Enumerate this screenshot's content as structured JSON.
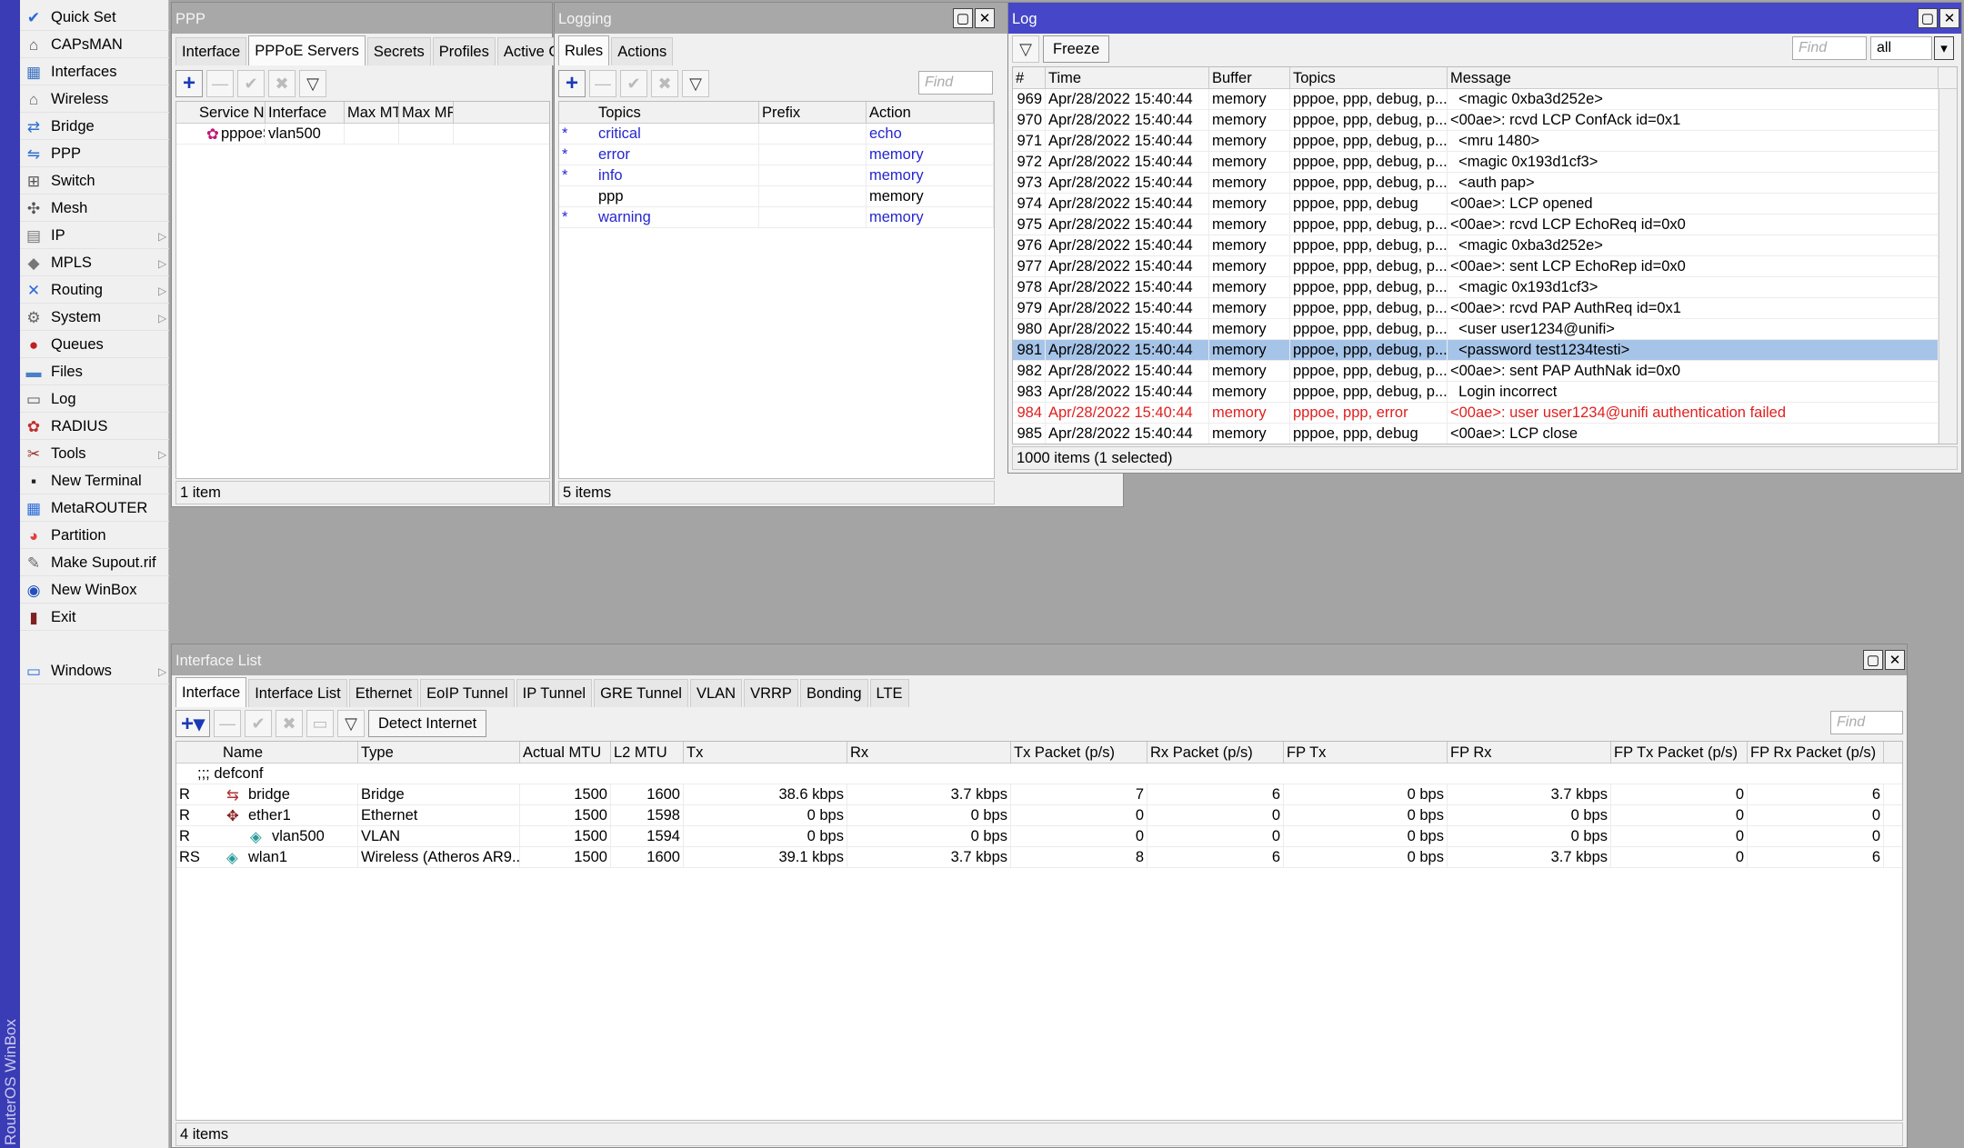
{
  "brand": "RouterOS WinBox",
  "menu": [
    {
      "label": "Quick Set",
      "icon": "quick-set-icon",
      "glyph": "✔",
      "sub": false
    },
    {
      "label": "CAPsMAN",
      "icon": "capsman-icon",
      "glyph": "⌂",
      "sub": false
    },
    {
      "label": "Interfaces",
      "icon": "interfaces-icon",
      "glyph": "▦",
      "sub": false
    },
    {
      "label": "Wireless",
      "icon": "wireless-icon",
      "glyph": "⌂",
      "sub": false
    },
    {
      "label": "Bridge",
      "icon": "bridge-icon",
      "glyph": "⇄",
      "sub": false
    },
    {
      "label": "PPP",
      "icon": "ppp-icon",
      "glyph": "⇋",
      "sub": false
    },
    {
      "label": "Switch",
      "icon": "switch-icon",
      "glyph": "⊞",
      "sub": false
    },
    {
      "label": "Mesh",
      "icon": "mesh-icon",
      "glyph": "✣",
      "sub": false
    },
    {
      "label": "IP",
      "icon": "ip-icon",
      "glyph": "▤",
      "sub": true
    },
    {
      "label": "MPLS",
      "icon": "mpls-icon",
      "glyph": "◆",
      "sub": true
    },
    {
      "label": "Routing",
      "icon": "routing-icon",
      "glyph": "✕",
      "sub": true
    },
    {
      "label": "System",
      "icon": "system-icon",
      "glyph": "⚙",
      "sub": true
    },
    {
      "label": "Queues",
      "icon": "queues-icon",
      "glyph": "●",
      "sub": false
    },
    {
      "label": "Files",
      "icon": "files-icon",
      "glyph": "▬",
      "sub": false
    },
    {
      "label": "Log",
      "icon": "log-icon",
      "glyph": "▭",
      "sub": false
    },
    {
      "label": "RADIUS",
      "icon": "radius-icon",
      "glyph": "✿",
      "sub": false
    },
    {
      "label": "Tools",
      "icon": "tools-icon",
      "glyph": "✂",
      "sub": true
    },
    {
      "label": "New Terminal",
      "icon": "terminal-icon",
      "glyph": "▪",
      "sub": false
    },
    {
      "label": "MetaROUTER",
      "icon": "metarouter-icon",
      "glyph": "▦",
      "sub": false
    },
    {
      "label": "Partition",
      "icon": "partition-icon",
      "glyph": "◕",
      "sub": false
    },
    {
      "label": "Make Supout.rif",
      "icon": "supout-icon",
      "glyph": "✎",
      "sub": false
    },
    {
      "label": "New WinBox",
      "icon": "winbox-icon",
      "glyph": "◉",
      "sub": false
    },
    {
      "label": "Exit",
      "icon": "exit-icon",
      "glyph": "▮",
      "sub": false
    },
    {
      "label": "Windows",
      "icon": "windows-icon",
      "glyph": "▭",
      "sub": true
    }
  ],
  "ppp": {
    "title": "PPP",
    "tabs": [
      "Interface",
      "PPPoE Servers",
      "Secrets",
      "Profiles",
      "Active Co"
    ],
    "selected_tab": 1,
    "columns": [
      "Service Na...",
      "Interface",
      "Max MTU",
      "Max MRU"
    ],
    "rows": [
      [
        "pppoeS...",
        "vlan500",
        "",
        ""
      ]
    ],
    "status": "1 item"
  },
  "logging": {
    "title": "Logging",
    "tabs": [
      "Rules",
      "Actions"
    ],
    "selected_tab": 0,
    "find": "Find",
    "columns": [
      "Topics",
      "Prefix",
      "Action"
    ],
    "rows": [
      {
        "mark": "*",
        "topics": "critical",
        "prefix": "",
        "action": "echo",
        "disabled": true
      },
      {
        "mark": "*",
        "topics": "error",
        "prefix": "",
        "action": "memory",
        "disabled": true
      },
      {
        "mark": "*",
        "topics": "info",
        "prefix": "",
        "action": "memory",
        "disabled": true
      },
      {
        "mark": "",
        "topics": "ppp",
        "prefix": "",
        "action": "memory",
        "disabled": false
      },
      {
        "mark": "*",
        "topics": "warning",
        "prefix": "",
        "action": "memory",
        "disabled": true
      }
    ],
    "status": "5 items"
  },
  "log": {
    "title": "Log",
    "freeze": "Freeze",
    "find": "Find",
    "filter_value": "all",
    "columns": [
      "#",
      "Time",
      "Buffer",
      "Topics",
      "Message"
    ],
    "rows": [
      {
        "n": "969",
        "time": "Apr/28/2022 15:40:44",
        "buf": "memory",
        "topics": "pppoe, ppp, debug, p...",
        "msg": "  <magic 0xba3d252e>",
        "st": ""
      },
      {
        "n": "970",
        "time": "Apr/28/2022 15:40:44",
        "buf": "memory",
        "topics": "pppoe, ppp, debug, p...",
        "msg": "<00ae>: rcvd LCP ConfAck id=0x1",
        "st": ""
      },
      {
        "n": "971",
        "time": "Apr/28/2022 15:40:44",
        "buf": "memory",
        "topics": "pppoe, ppp, debug, p...",
        "msg": "  <mru 1480>",
        "st": ""
      },
      {
        "n": "972",
        "time": "Apr/28/2022 15:40:44",
        "buf": "memory",
        "topics": "pppoe, ppp, debug, p...",
        "msg": "  <magic 0x193d1cf3>",
        "st": ""
      },
      {
        "n": "973",
        "time": "Apr/28/2022 15:40:44",
        "buf": "memory",
        "topics": "pppoe, ppp, debug, p...",
        "msg": "  <auth pap>",
        "st": ""
      },
      {
        "n": "974",
        "time": "Apr/28/2022 15:40:44",
        "buf": "memory",
        "topics": "pppoe, ppp, debug",
        "msg": "<00ae>: LCP opened",
        "st": ""
      },
      {
        "n": "975",
        "time": "Apr/28/2022 15:40:44",
        "buf": "memory",
        "topics": "pppoe, ppp, debug, p...",
        "msg": "<00ae>: rcvd LCP EchoReq id=0x0",
        "st": ""
      },
      {
        "n": "976",
        "time": "Apr/28/2022 15:40:44",
        "buf": "memory",
        "topics": "pppoe, ppp, debug, p...",
        "msg": "  <magic 0xba3d252e>",
        "st": ""
      },
      {
        "n": "977",
        "time": "Apr/28/2022 15:40:44",
        "buf": "memory",
        "topics": "pppoe, ppp, debug, p...",
        "msg": "<00ae>: sent LCP EchoRep id=0x0",
        "st": ""
      },
      {
        "n": "978",
        "time": "Apr/28/2022 15:40:44",
        "buf": "memory",
        "topics": "pppoe, ppp, debug, p...",
        "msg": "  <magic 0x193d1cf3>",
        "st": ""
      },
      {
        "n": "979",
        "time": "Apr/28/2022 15:40:44",
        "buf": "memory",
        "topics": "pppoe, ppp, debug, p...",
        "msg": "<00ae>: rcvd PAP AuthReq id=0x1",
        "st": ""
      },
      {
        "n": "980",
        "time": "Apr/28/2022 15:40:44",
        "buf": "memory",
        "topics": "pppoe, ppp, debug, p...",
        "msg": "  <user user1234@unifi>",
        "st": ""
      },
      {
        "n": "981",
        "time": "Apr/28/2022 15:40:44",
        "buf": "memory",
        "topics": "pppoe, ppp, debug, p...",
        "msg": "  <password test1234testi>",
        "st": "sel"
      },
      {
        "n": "982",
        "time": "Apr/28/2022 15:40:44",
        "buf": "memory",
        "topics": "pppoe, ppp, debug, p...",
        "msg": "<00ae>: sent PAP AuthNak id=0x0",
        "st": ""
      },
      {
        "n": "983",
        "time": "Apr/28/2022 15:40:44",
        "buf": "memory",
        "topics": "pppoe, ppp, debug, p...",
        "msg": "  Login incorrect",
        "st": ""
      },
      {
        "n": "984",
        "time": "Apr/28/2022 15:40:44",
        "buf": "memory",
        "topics": "pppoe, ppp, error",
        "msg": "<00ae>: user user1234@unifi authentication failed",
        "st": "err"
      },
      {
        "n": "985",
        "time": "Apr/28/2022 15:40:44",
        "buf": "memory",
        "topics": "pppoe, ppp, debug",
        "msg": "<00ae>: LCP close",
        "st": ""
      }
    ],
    "status": "1000 items (1 selected)"
  },
  "iflist": {
    "title": "Interface List",
    "tabs": [
      "Interface",
      "Interface List",
      "Ethernet",
      "EoIP Tunnel",
      "IP Tunnel",
      "GRE Tunnel",
      "VLAN",
      "VRRP",
      "Bonding",
      "LTE"
    ],
    "selected_tab": 0,
    "detect": "Detect Internet",
    "find": "Find",
    "columns": [
      "Name",
      "Type",
      "Actual MTU",
      "L2 MTU",
      "Tx",
      "Rx",
      "Tx Packet (p/s)",
      "Rx Packet (p/s)",
      "FP Tx",
      "FP Rx",
      "FP Tx Packet (p/s)",
      "FP Rx Packet (p/s)"
    ],
    "comment": ";;; defconf",
    "rows": [
      {
        "flag": "R",
        "name": "bridge",
        "type": "Bridge",
        "amtu": "1500",
        "l2": "1600",
        "tx": "38.6 kbps",
        "rx": "3.7 kbps",
        "txp": "7",
        "rxp": "6",
        "fptx": "0 bps",
        "fprx": "3.7 kbps",
        "fptxp": "0",
        "fprxp": "6",
        "indent": false,
        "icon": "bridge-port-icon"
      },
      {
        "flag": "R",
        "name": "ether1",
        "type": "Ethernet",
        "amtu": "1500",
        "l2": "1598",
        "tx": "0 bps",
        "rx": "0 bps",
        "txp": "0",
        "rxp": "0",
        "fptx": "0 bps",
        "fprx": "0 bps",
        "fptxp": "0",
        "fprxp": "0",
        "indent": false,
        "icon": "ethernet-port-icon"
      },
      {
        "flag": "R",
        "name": "vlan500",
        "type": "VLAN",
        "amtu": "1500",
        "l2": "1594",
        "tx": "0 bps",
        "rx": "0 bps",
        "txp": "0",
        "rxp": "0",
        "fptx": "0 bps",
        "fprx": "0 bps",
        "fptxp": "0",
        "fprxp": "0",
        "indent": true,
        "icon": "vlan-port-icon"
      },
      {
        "flag": "RS",
        "name": "wlan1",
        "type": "Wireless (Atheros AR9...",
        "amtu": "1500",
        "l2": "1600",
        "tx": "39.1 kbps",
        "rx": "3.7 kbps",
        "txp": "8",
        "rxp": "6",
        "fptx": "0 bps",
        "fprx": "3.7 kbps",
        "fptxp": "0",
        "fprxp": "6",
        "indent": false,
        "icon": "wireless-port-icon"
      }
    ],
    "status": "4 items"
  }
}
